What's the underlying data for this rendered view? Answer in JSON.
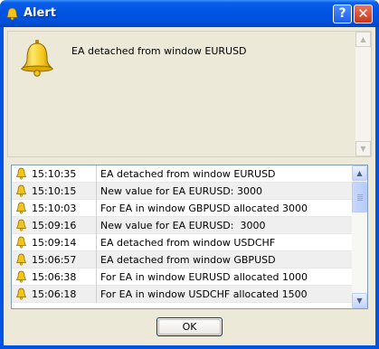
{
  "window": {
    "title": "Alert",
    "help_glyph": "?",
    "close_glyph": "✕"
  },
  "message": {
    "text": "EA detached from window EURUSD",
    "icon": "bell-icon"
  },
  "list": {
    "rows": [
      {
        "time": "15:10:35",
        "text": "EA detached from window EURUSD"
      },
      {
        "time": "15:10:15",
        "text": "New value for EA EURUSD: 3000"
      },
      {
        "time": "15:10:03",
        "text": "For EA in window GBPUSD allocated 3000"
      },
      {
        "time": "15:09:16",
        "text": "New value for EA EURUSD:  3000"
      },
      {
        "time": "15:09:14",
        "text": "EA detached from window USDCHF"
      },
      {
        "time": "15:06:57",
        "text": "EA detached from window GBPUSD"
      },
      {
        "time": "15:06:38",
        "text": "For EA in window EURUSD allocated 1000"
      },
      {
        "time": "15:06:18",
        "text": "For EA in window USDCHF allocated 1500"
      }
    ]
  },
  "buttons": {
    "ok_label": "OK"
  },
  "colors": {
    "title_bar": "#0054e3",
    "dialog_bg": "#ece9d8",
    "bell": "#f3c51a"
  }
}
